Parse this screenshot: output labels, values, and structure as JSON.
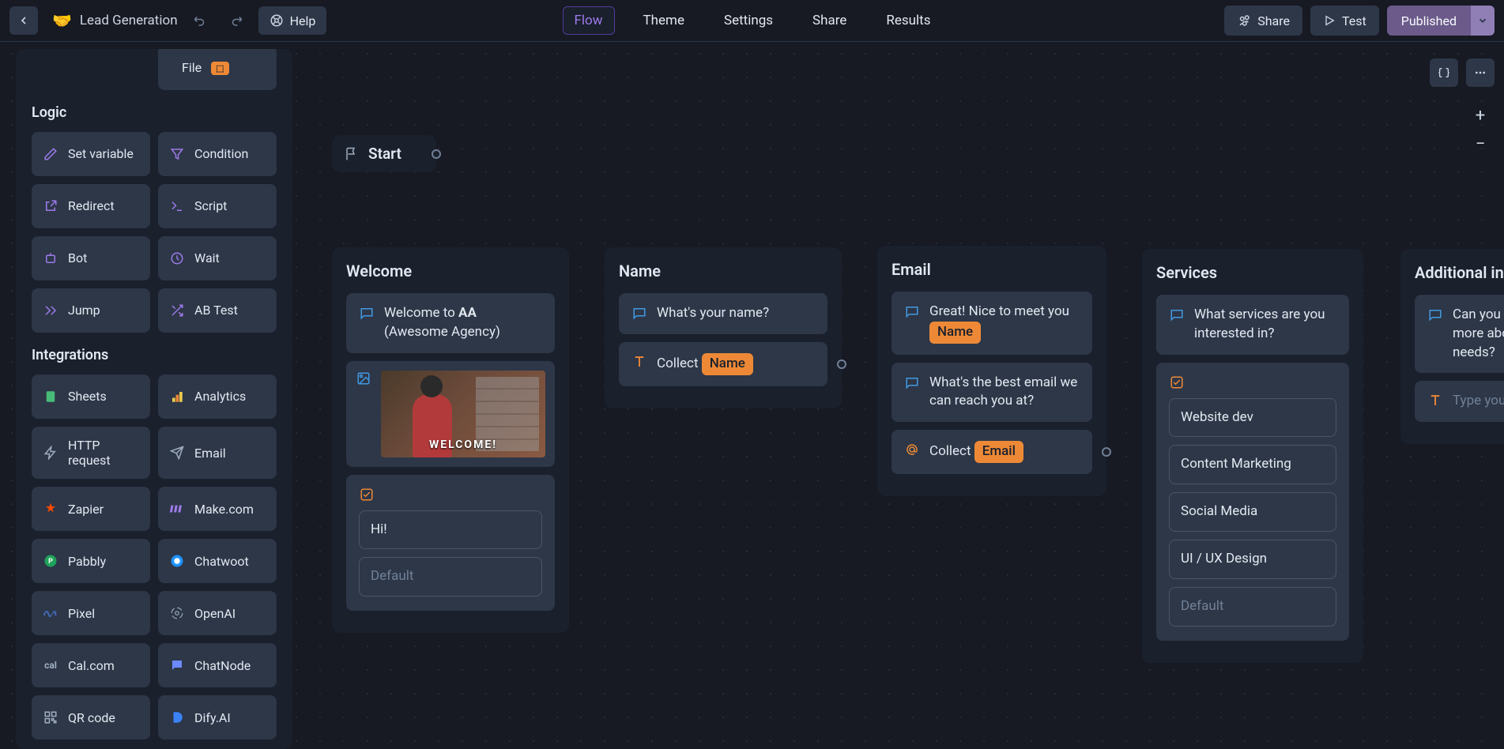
{
  "breadcrumb": {
    "emoji": "🤝",
    "title": "Lead Generation"
  },
  "help_label": "Help",
  "nav": {
    "flow": "Flow",
    "theme": "Theme",
    "settings": "Settings",
    "share": "Share",
    "results": "Results"
  },
  "actions": {
    "share": "Share",
    "test": "Test",
    "published": "Published"
  },
  "sidebar": {
    "partial_top": {
      "file": "File"
    },
    "logic_title": "Logic",
    "logic": {
      "set_variable": "Set variable",
      "condition": "Condition",
      "redirect": "Redirect",
      "script": "Script",
      "bot": "Bot",
      "wait": "Wait",
      "jump": "Jump",
      "abtest": "AB Test"
    },
    "integrations_title": "Integrations",
    "integrations": {
      "sheets": "Sheets",
      "analytics": "Analytics",
      "http": "HTTP request",
      "email": "Email",
      "zapier": "Zapier",
      "make": "Make.com",
      "pabbly": "Pabbly",
      "chatwoot": "Chatwoot",
      "pixel": "Pixel",
      "openai": "OpenAI",
      "calcom": "Cal.com",
      "chatnode": "ChatNode",
      "qrcode": "QR code",
      "dify": "Dify.AI"
    }
  },
  "flow": {
    "start": "Start",
    "welcome": {
      "title": "Welcome",
      "msg_prefix": "Welcome to ",
      "msg_bold": "AA",
      "msg_suffix": " (Awesome Agency)",
      "image_caption": "WELCOME!",
      "opt_hi": "Hi!",
      "opt_default": "Default"
    },
    "name": {
      "title": "Name",
      "question": "What's your name?",
      "collect": "Collect",
      "var": "Name"
    },
    "email": {
      "title": "Email",
      "greet_prefix": "Great! Nice to meet you ",
      "greet_var": "Name",
      "question": "What's the best email we can reach you at?",
      "collect": "Collect",
      "var": "Email"
    },
    "services": {
      "title": "Services",
      "question": "What services are you interested in?",
      "opts": [
        "Website dev",
        "Content Marketing",
        "Social Media",
        "UI / UX Design",
        "Default"
      ]
    },
    "additional": {
      "title": "Additional information",
      "question_partial": "Can you t\nmore abo\nneeds?",
      "input_placeholder": "Type you"
    }
  }
}
